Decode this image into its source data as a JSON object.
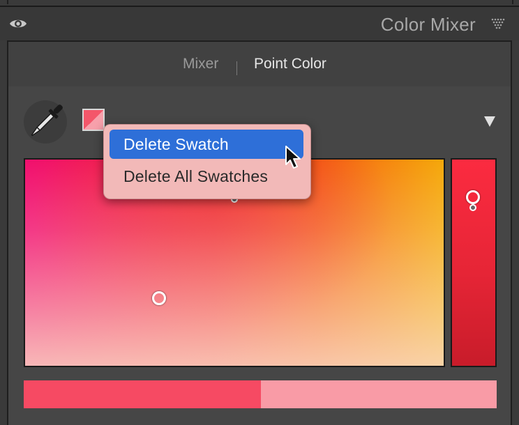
{
  "panel": {
    "title": "Color Mixer"
  },
  "tabs": [
    {
      "label": "Mixer",
      "active": false
    },
    {
      "label": "Point Color",
      "active": true
    }
  ],
  "swatch": {
    "primary_color": "#f4566a",
    "secondary_color": "#f7a0ab"
  },
  "context_menu": {
    "items": [
      {
        "label": "Delete Swatch",
        "highlighted": true
      },
      {
        "label": "Delete All Swatches",
        "highlighted": false
      }
    ]
  },
  "compare_bar": {
    "before_color": "#f64a63",
    "after_color": "#f99ba6"
  },
  "colors": {
    "accent_highlight": "#2e6fd8",
    "menu_background": "#f2b9b8",
    "panel_background": "#464646"
  },
  "icons": {
    "visibility": "eye-icon",
    "panel_menu": "triangle-dots-icon",
    "picker": "eyedropper-icon",
    "collapse": "triangle-down-icon"
  }
}
